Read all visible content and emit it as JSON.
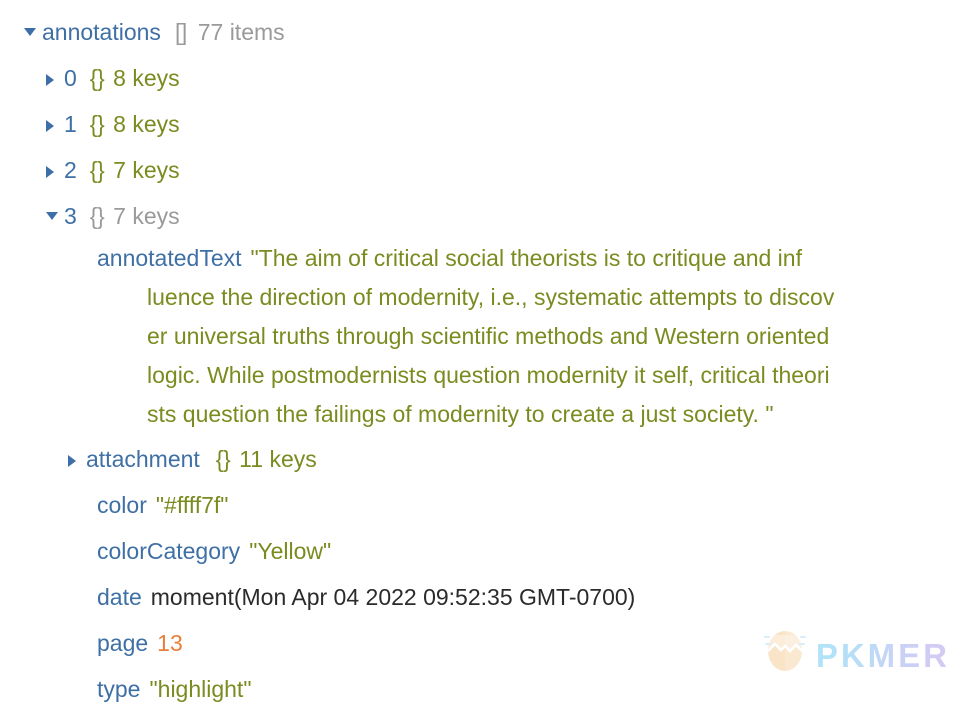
{
  "tree": {
    "root": {
      "arrow": "expanded",
      "key": "annotations",
      "type_token": "[]",
      "count": "77 items"
    },
    "items": [
      {
        "arrow": "collapsed",
        "index": "0",
        "type_token": "{}",
        "count": "8 keys"
      },
      {
        "arrow": "collapsed",
        "index": "1",
        "type_token": "{}",
        "count": "8 keys"
      },
      {
        "arrow": "collapsed",
        "index": "2",
        "type_token": "{}",
        "count": "7 keys"
      },
      {
        "arrow": "expanded",
        "index": "3",
        "type_token": "{}",
        "count": "7 keys"
      }
    ],
    "expanded_item": {
      "annotatedText": {
        "key": "annotatedText",
        "value_lines": [
          "\"The aim of critical social theorists is to critique and inf",
          "luence the direction of modernity, i.e., systematic attempts to discov",
          "er universal truths through scientific methods and Western oriented",
          "logic. While postmodernists question modernity it self, critical theori",
          "sts question the failings of modernity to create a just society. \""
        ],
        "value_full": "\"The aim of critical social theorists is to critique and influence the direction of modernity, i.e., systematic attempts to discover universal truths through scientific methods and Western oriented logic. While postmodernists question modernity it self, critical theorists question the failings of modernity to create a just society. \""
      },
      "attachment": {
        "arrow": "collapsed",
        "key": "attachment",
        "type_token": "{}",
        "count": "11 keys"
      },
      "color": {
        "key": "color",
        "value": "\"#ffff7f\""
      },
      "colorCategory": {
        "key": "colorCategory",
        "value": "\"Yellow\""
      },
      "date": {
        "key": "date",
        "value": "moment(Mon Apr 04 2022 09:52:35 GMT-0700)"
      },
      "page": {
        "key": "page",
        "value": "13"
      },
      "type": {
        "key": "type",
        "value": "\"highlight\""
      }
    }
  },
  "watermark": {
    "brand": "PKMER",
    "icon": "pkmer-egg-logo"
  },
  "colors": {
    "key_blue": "#3e6fa5",
    "string_olive": "#7a8b1f",
    "number_orange": "#e8803a",
    "meta_gray": "#9a9a9a",
    "plain_text": "#2b2b2b",
    "background": "#ffffff"
  }
}
